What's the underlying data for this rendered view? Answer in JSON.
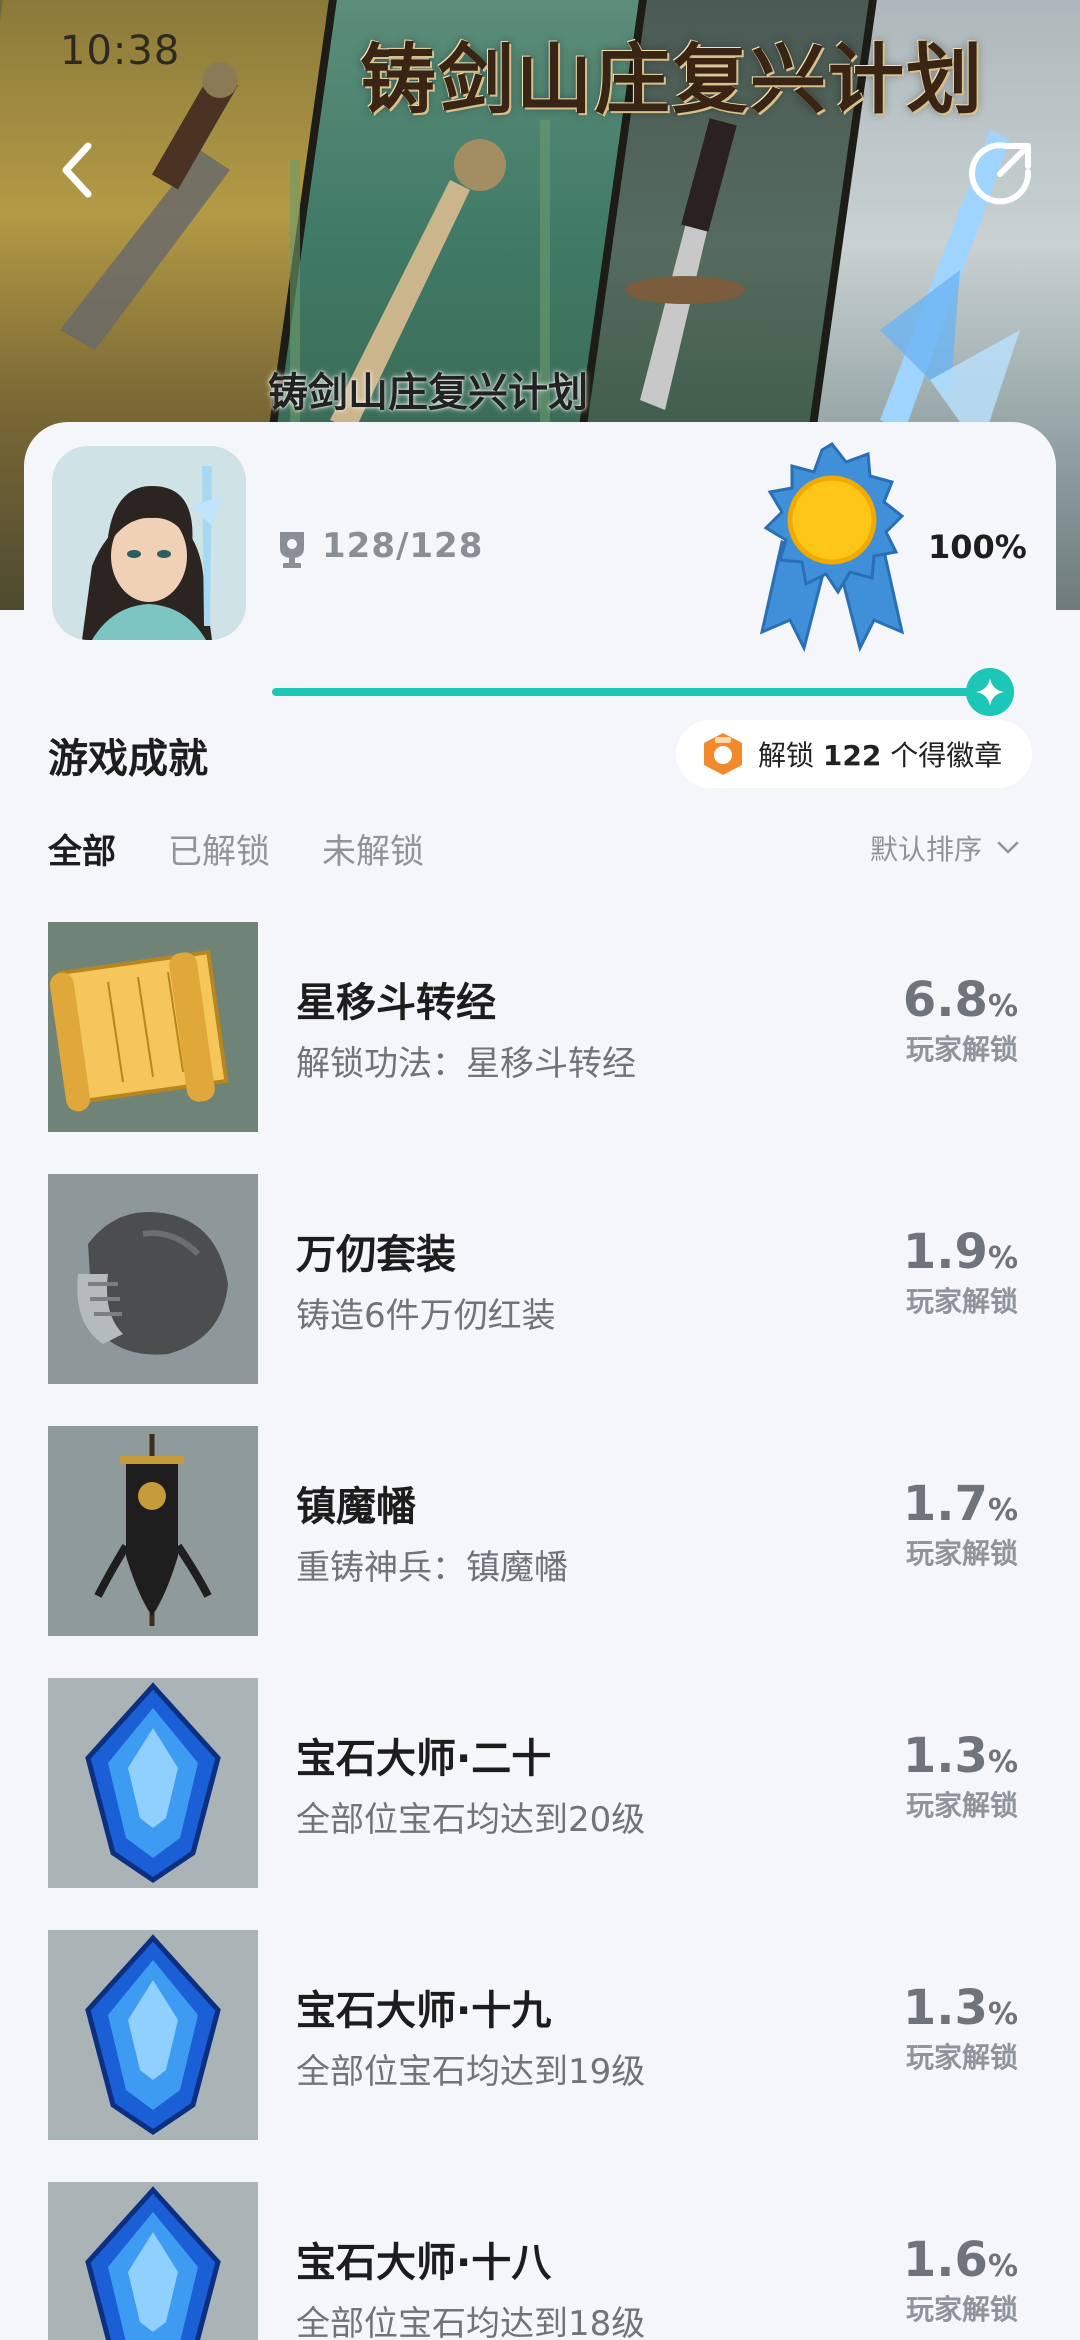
{
  "status_bar": {
    "time": "10:38"
  },
  "banner": {
    "title": "铸剑山庄复兴计划",
    "subtitle": "铸剑山庄复兴计划"
  },
  "header": {
    "trophy_count": "128/128",
    "completion_percent": "100%",
    "progress": 1.0
  },
  "section": {
    "title": "游戏成就",
    "badge_prefix": "解锁",
    "badge_count": "122",
    "badge_suffix": "个得徽章"
  },
  "tabs": [
    {
      "label": "全部",
      "active": true
    },
    {
      "label": "已解锁",
      "active": false
    },
    {
      "label": "未解锁",
      "active": false
    }
  ],
  "sort": {
    "label": "默认排序"
  },
  "achievements": [
    {
      "title": "星移斗转经",
      "desc": "解锁功法：星移斗转经",
      "rate": "6.8",
      "pct": "%",
      "rate_label": "玩家解锁",
      "icon": "scroll-icon"
    },
    {
      "title": "万仞套装",
      "desc": "铸造6件万仞红装",
      "rate": "1.9",
      "pct": "%",
      "rate_label": "玩家解锁",
      "icon": "armor-icon"
    },
    {
      "title": "镇魔幡",
      "desc": "重铸神兵：镇魔幡",
      "rate": "1.7",
      "pct": "%",
      "rate_label": "玩家解锁",
      "icon": "banner-flag-icon"
    },
    {
      "title": "宝石大师·二十",
      "desc": "全部位宝石均达到20级",
      "rate": "1.3",
      "pct": "%",
      "rate_label": "玩家解锁",
      "icon": "gem-icon"
    },
    {
      "title": "宝石大师·十九",
      "desc": "全部位宝石均达到19级",
      "rate": "1.3",
      "pct": "%",
      "rate_label": "玩家解锁",
      "icon": "gem-icon"
    },
    {
      "title": "宝石大师·十八",
      "desc": "全部位宝石均达到18级",
      "rate": "1.6",
      "pct": "%",
      "rate_label": "玩家解锁",
      "icon": "gem-icon"
    }
  ],
  "colors": {
    "accent": "#1cc7b7",
    "page_bg": "#f4f6f9",
    "medal_gold": "#ffc61a",
    "medal_ribbon": "#3f8fd9"
  }
}
